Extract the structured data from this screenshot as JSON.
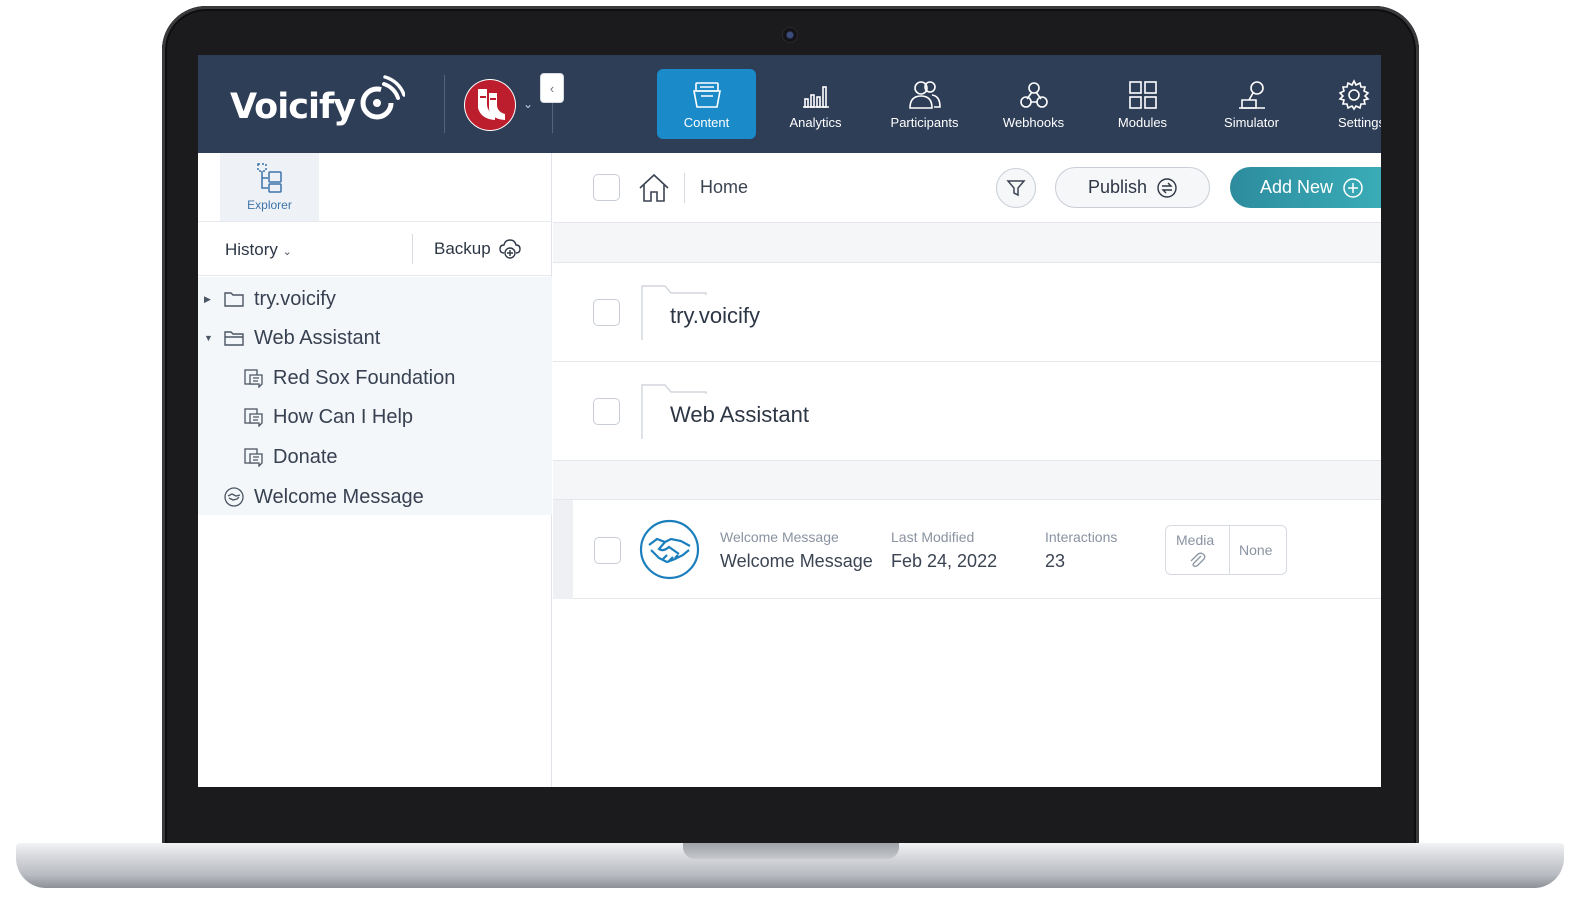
{
  "app": {
    "logo_text": "Voicify"
  },
  "nav": {
    "items": [
      {
        "label": "Content",
        "icon": "content-icon",
        "active": true
      },
      {
        "label": "Analytics",
        "icon": "analytics-icon",
        "active": false
      },
      {
        "label": "Participants",
        "icon": "participants-icon",
        "active": false
      },
      {
        "label": "Webhooks",
        "icon": "webhooks-icon",
        "active": false
      },
      {
        "label": "Modules",
        "icon": "modules-icon",
        "active": false
      },
      {
        "label": "Simulator",
        "icon": "simulator-icon",
        "active": false
      },
      {
        "label": "Settings",
        "icon": "gear-icon",
        "active": false
      }
    ]
  },
  "sidebar": {
    "explorer_label": "Explorer",
    "history_label": "History",
    "backup_label": "Backup",
    "tree": [
      {
        "label": "try.voicify",
        "type": "folder",
        "expanded": false
      },
      {
        "label": "Web Assistant",
        "type": "folder",
        "expanded": true
      },
      {
        "label": "Red Sox Foundation",
        "type": "conversation"
      },
      {
        "label": "How Can I Help",
        "type": "conversation"
      },
      {
        "label": "Donate",
        "type": "conversation"
      },
      {
        "label": "Welcome Message",
        "type": "welcome"
      }
    ]
  },
  "toolbar": {
    "breadcrumb": "Home",
    "publish_label": "Publish",
    "add_new_label": "Add New"
  },
  "content": {
    "folders": [
      {
        "name": "try.voicify"
      },
      {
        "name": "Web Assistant"
      }
    ],
    "items": [
      {
        "type_label": "Welcome Message",
        "title": "Welcome Message",
        "last_modified_label": "Last Modified",
        "last_modified": "Feb 24, 2022",
        "interactions_label": "Interactions",
        "interactions": "23",
        "media_label": "Media",
        "media_value": "None"
      }
    ]
  },
  "colors": {
    "topbar": "#2f3e57",
    "active_nav": "#1b8ac9",
    "add_new": "#3aaeb8",
    "brand_red": "#bd1e2d"
  }
}
